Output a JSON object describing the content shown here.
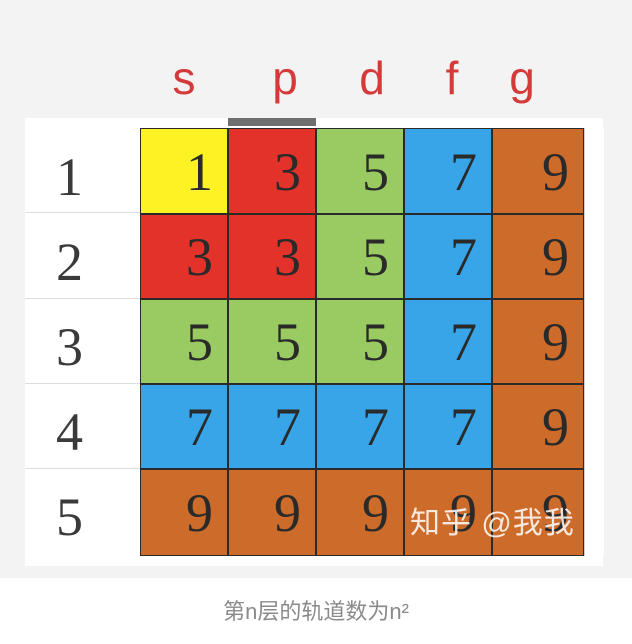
{
  "columns": [
    "s",
    "p",
    "d",
    "f",
    "g"
  ],
  "row_labels": [
    "1",
    "2",
    "3",
    "4",
    "5"
  ],
  "grid": [
    [
      "1",
      "3",
      "5",
      "7",
      "9"
    ],
    [
      "3",
      "3",
      "5",
      "7",
      "9"
    ],
    [
      "5",
      "5",
      "5",
      "7",
      "9"
    ],
    [
      "7",
      "7",
      "7",
      "7",
      "9"
    ],
    [
      "9",
      "9",
      "9",
      "9",
      "9"
    ]
  ],
  "colors": {
    "1": "#fcf224",
    "3": "#e3322a",
    "5": "#9acb63",
    "7": "#38a5e8",
    "9": "#cc6b2a",
    "header_letters": "#d43a3a"
  },
  "watermark": "知乎 @我我",
  "caption": "第n层的轨道数为n²"
}
